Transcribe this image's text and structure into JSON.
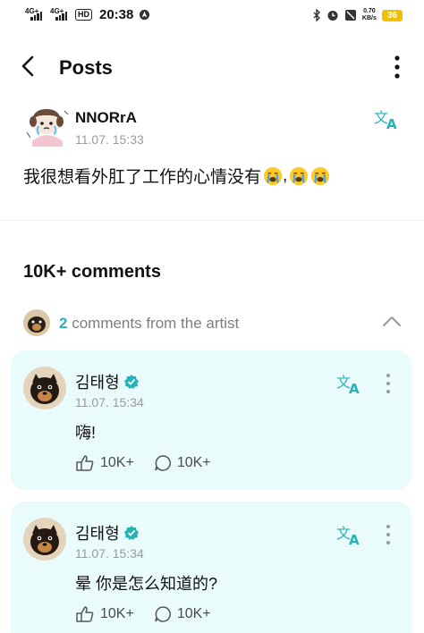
{
  "status_bar": {
    "network_1": "4G+",
    "network_2": "4G+",
    "hd_label": "HD",
    "time": "20:38",
    "speed_value": "0.70",
    "speed_unit": "KB/s",
    "battery": "36"
  },
  "header": {
    "title": "Posts"
  },
  "post": {
    "author": "NNORrA",
    "timestamp": "11.07. 15:33",
    "body_text": "我很想看外肛了工作的心情没有",
    "emoji_separator": ","
  },
  "comments": {
    "count_label": "10K+ comments",
    "artist_count": "2",
    "artist_label": "comments from the artist",
    "items": [
      {
        "name": "김태형",
        "timestamp": "11.07. 15:34",
        "text": "嗨!",
        "likes": "10K+",
        "replies": "10K+"
      },
      {
        "name": "김태형",
        "timestamp": "11.07. 15:34",
        "text": "晕 你是怎么知道的?",
        "likes": "10K+",
        "replies": "10K+"
      }
    ]
  },
  "colors": {
    "accent": "#26b3b8",
    "card_background": "#e9fbfb",
    "battery": "#f0c000"
  }
}
